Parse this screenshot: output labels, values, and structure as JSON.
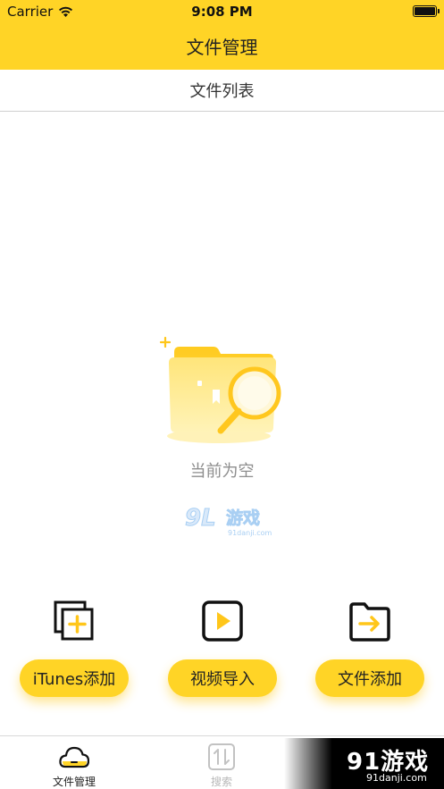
{
  "status_bar": {
    "carrier": "Carrier",
    "time": "9:08 PM"
  },
  "nav": {
    "title": "文件管理"
  },
  "subheader": {
    "title": "文件列表"
  },
  "empty_state": {
    "message": "当前为空",
    "illustration": "empty-folder-search-icon"
  },
  "watermark": {
    "logo_text": "91游戏",
    "logo_sub": "91danji.com"
  },
  "actions": [
    {
      "label": "iTunes添加",
      "icon": "itunes-add-icon"
    },
    {
      "label": "视频导入",
      "icon": "video-import-icon"
    },
    {
      "label": "文件添加",
      "icon": "file-add-icon"
    }
  ],
  "tab_bar": {
    "items": [
      {
        "label": "文件管理",
        "icon": "cloud-icon",
        "active": true
      },
      {
        "label": "搜索",
        "icon": "sort-arrows-icon",
        "active": false
      }
    ]
  },
  "colors": {
    "accent": "#FFD426",
    "text_primary": "#222222",
    "text_muted": "#8E8E8E",
    "tab_inactive": "#B8B8B8"
  }
}
